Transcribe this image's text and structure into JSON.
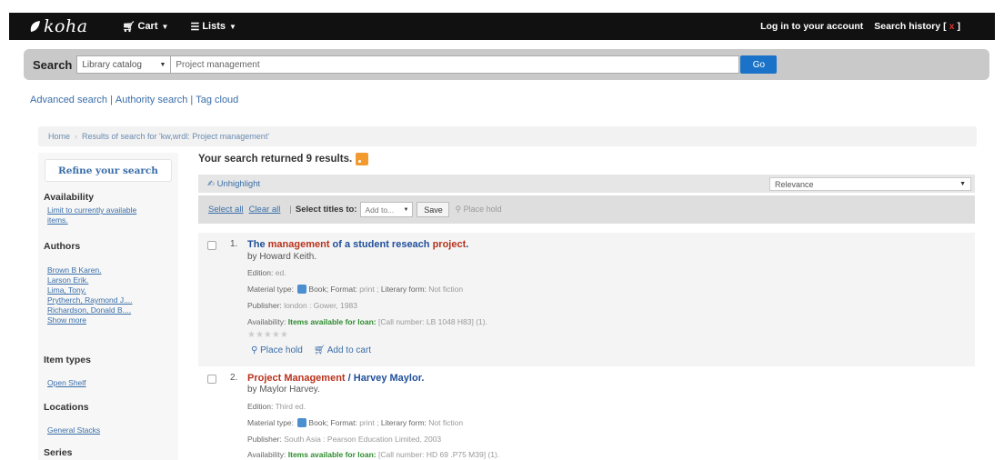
{
  "navbar": {
    "logo_text": "koha",
    "cart_label": "Cart",
    "lists_label": "Lists",
    "login_label": "Log in to your account",
    "history_label": "Search history",
    "history_clear": "x"
  },
  "search": {
    "label": "Search",
    "scope_selected": "Library catalog",
    "query_value": "Project management",
    "go_label": "Go"
  },
  "links": {
    "advanced": "Advanced search",
    "authority": "Authority search",
    "tagcloud": "Tag cloud"
  },
  "breadcrumb": {
    "home": "Home",
    "current": "Results of search for 'kw,wrdl: Project management'"
  },
  "sidebar": {
    "refine": "Refine your search",
    "availability_heading": "Availability",
    "availability_link_1": "Limit to currently available",
    "availability_link_2": "items.",
    "authors_heading": "Authors",
    "authors": [
      "Brown B Karen.",
      "Larson Erik.",
      "Lima, Tony.",
      "Prytherch, Raymond J....",
      "Richardson, Donald B....",
      "Show more"
    ],
    "itemtypes_heading": "Item types",
    "itemtypes": [
      "Open Shelf"
    ],
    "locations_heading": "Locations",
    "locations": [
      "General Stacks"
    ],
    "series_heading": "Series"
  },
  "results": {
    "count_text": "Your search returned 9 results.",
    "unhighlight": "Unhighlight",
    "sort_selected": "Relevance",
    "select_all": "Select all",
    "clear_all": "Clear all",
    "select_titles": "Select titles to:",
    "add_to": "Add to...",
    "save": "Save",
    "place_hold": "Place hold",
    "items": [
      {
        "num": "1.",
        "title_pre": "The ",
        "title_hl1": "management",
        "title_mid": " of a student reseach ",
        "title_hl2": "project",
        "title_post": ".",
        "by": "by Howard Keith.",
        "edition_label": "Edition:",
        "edition_value": "ed.",
        "material_label": "Material type:",
        "material_value": "Book;",
        "format_label": "Format:",
        "format_value": "print ;",
        "literary_label": "Literary form:",
        "literary_value": "Not fiction",
        "publisher_label": "Publisher:",
        "publisher_value": "london : Gower, 1983",
        "availability_label": "Availability:",
        "availability_value": "Items available for loan:",
        "availability_rest": "[Call number: LB 1048 H83] (1).",
        "stars": "★★★★★",
        "place_hold": "Place hold",
        "add_to_cart": "Add to cart"
      },
      {
        "num": "2.",
        "title_hl1": "Project Management",
        "title_post": " / Harvey Maylor.",
        "by": "by Maylor Harvey.",
        "edition_label": "Edition:",
        "edition_value": "Third ed.",
        "material_label": "Material type:",
        "material_value": "Book;",
        "format_label": "Format:",
        "format_value": "print ;",
        "literary_label": "Literary form:",
        "literary_value": "Not fiction",
        "publisher_label": "Publisher:",
        "publisher_value": "South Asia : Pearson Education Limited, 2003",
        "availability_label": "Availability:",
        "availability_value": "Items available for loan:",
        "availability_rest": "[Call number: HD 69 .P75 M39] (1)."
      }
    ]
  },
  "colors": {
    "navbar": "#111111",
    "link": "#3a6ea8",
    "go_button": "#1a73c8",
    "highlight": "#b8321c",
    "available": "#2e8b2e",
    "rss": "#f29a2e"
  }
}
